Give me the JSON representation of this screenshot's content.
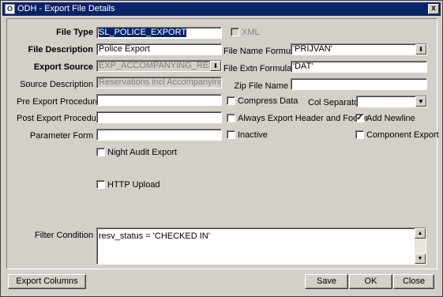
{
  "window": {
    "title": "ODH - Export File Details",
    "close_glyph": "x",
    "icon_glyph": "O"
  },
  "labels": {
    "file_type": "File Type",
    "xml": "XML",
    "file_description": "File Description",
    "file_name_formula": "File Name Formula",
    "export_source": "Export Source",
    "file_extn_formula": "File Extn Formula",
    "source_description": "Source Description",
    "zip_file_name": "Zip File Name",
    "pre_export_procedure": "Pre Export Procedure",
    "compress_data": "Compress Data",
    "col_separator": "Col Separator",
    "post_export_procedure": "Post Export Procedure",
    "always_export_header_footer": "Always Export Header and Footer",
    "add_newline": "Add Newline",
    "parameter_form": "Parameter Form",
    "inactive": "Inactive",
    "component_export": "Component Export",
    "night_audit_export": "Night Audit Export",
    "http_upload": "HTTP Upload",
    "filter_condition": "Filter Condition"
  },
  "values": {
    "file_type": "SL_POLICE_EXPORT",
    "file_description": "Police Export",
    "file_name_formula": "'PRIJVAN'",
    "export_source": "EXP_ACCOMPANYING_RESV_VIE",
    "file_extn_formula": "'DAT'",
    "source_description": "Reservations incl Accompanying Gues",
    "zip_file_name": "",
    "pre_export_procedure": "",
    "col_separator": "",
    "post_export_procedure": "",
    "parameter_form": "",
    "filter_condition": "resv_status = 'CHECKED IN'"
  },
  "checks": {
    "xml": false,
    "compress_data": false,
    "always_export_header_footer": false,
    "add_newline": true,
    "inactive": false,
    "component_export": false,
    "night_audit_export": false,
    "http_upload": false,
    "checked_glyph": "✓"
  },
  "glyphs": {
    "lov": "⬇",
    "dropdown": "▼",
    "scroll_up": "▲",
    "scroll_down": "▼"
  },
  "buttons": {
    "export_columns": "Export Columns",
    "save": "Save",
    "ok": "OK",
    "close": "Close"
  }
}
